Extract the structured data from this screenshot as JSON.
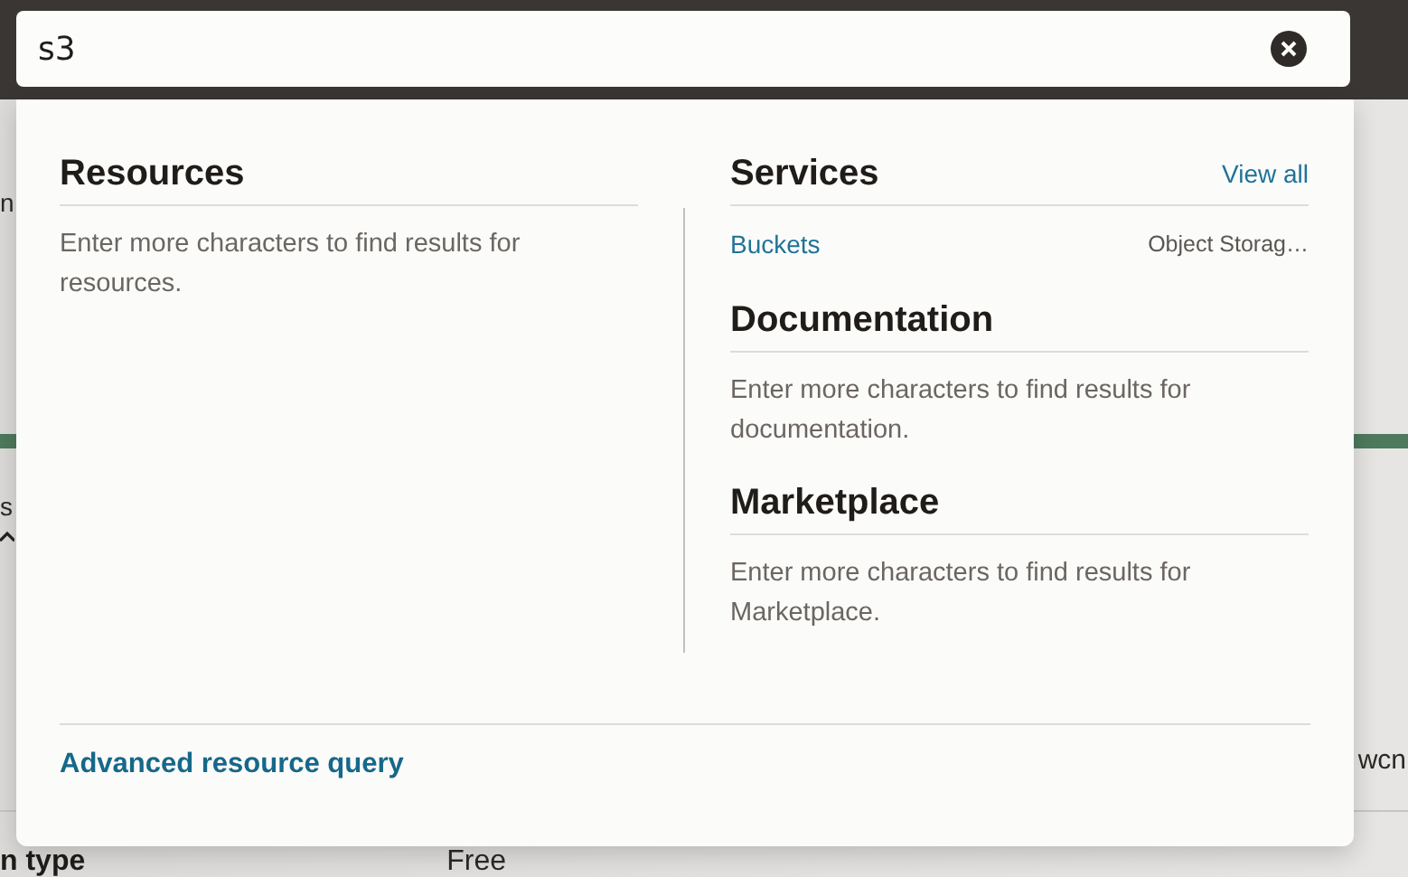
{
  "search": {
    "value": "s3"
  },
  "resources": {
    "title": "Resources",
    "message": "Enter more characters to find results for resources."
  },
  "services": {
    "title": "Services",
    "view_all": "View all",
    "results": [
      {
        "name": "Buckets",
        "category": "Object Storag…"
      }
    ]
  },
  "documentation": {
    "title": "Documentation",
    "message": "Enter more characters to find results for documentation."
  },
  "marketplace": {
    "title": "Marketplace",
    "message": "Enter more characters to find results for Marketplace."
  },
  "footer_link": "Advanced resource query",
  "background": {
    "breadcrumb": "n",
    "tab": "s",
    "value_1": "wcn",
    "label": "n type",
    "value_2": "Free"
  }
}
